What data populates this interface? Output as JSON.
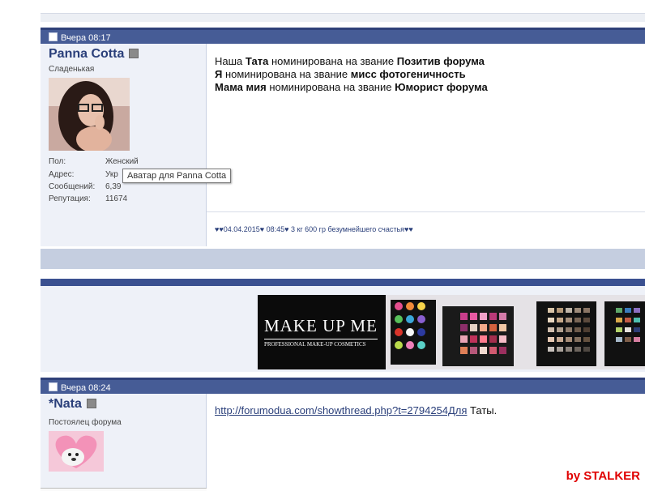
{
  "post1": {
    "time": "Вчера 08:17",
    "username": "Panna Cotta",
    "user_title": "Сладенькая",
    "stats": [
      {
        "label": "Пол:",
        "value": "Женский"
      },
      {
        "label": "Адрес:",
        "value": "Укр"
      },
      {
        "label": "Сообщений:",
        "value": "6,39"
      },
      {
        "label": "Репутация:",
        "value": "11674"
      }
    ],
    "tooltip": "Аватар для Panna Cotta",
    "lines": [
      [
        "Наша ",
        "Тата",
        " номинирована на звание ",
        "Позитив форума"
      ],
      [
        "Я",
        " номинирована на звание ",
        "мисс фотогеничность",
        ""
      ],
      [
        "Мама мия",
        " номинирована на звание ",
        "Юморист форума",
        ""
      ]
    ],
    "signature": "♥♥04.04.2015♥ 08:45♥ 3 кг 600 гр безумнейшего счастья♥♥"
  },
  "ad": {
    "brand": "MAKE UP ME",
    "tagline": "PROFESSIONAL MAKE-UP COSMETICS",
    "palette_label": "MAKE UP ME"
  },
  "post2": {
    "time": "Вчера 08:24",
    "username": "*Nata",
    "user_title": "Постоялец форума",
    "link": "http://forumodua.com/showthread.php?t=2794254Для",
    "after_link": " Таты."
  },
  "watermark": "by STALKER",
  "colors": {
    "header": "#465c96",
    "side": "#eef1f8",
    "accent": "#2a3f7a",
    "watermark": "#e00000"
  }
}
